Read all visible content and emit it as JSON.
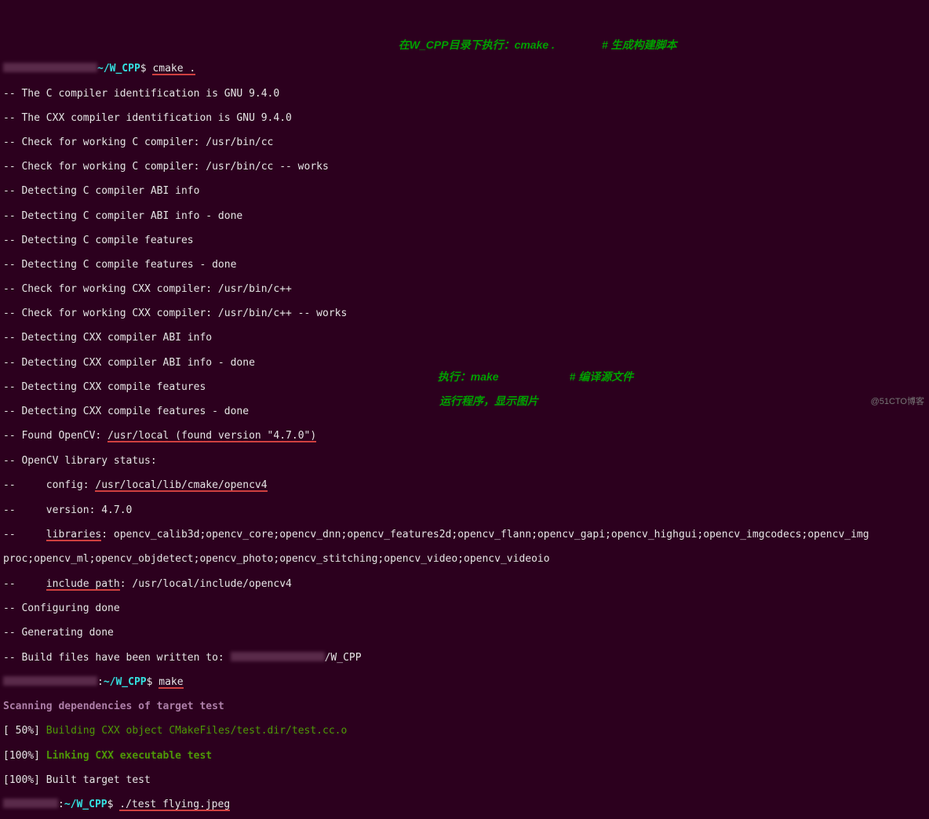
{
  "prompt1": {
    "path": "~/W_CPP",
    "sep": "$ ",
    "cmd": "cmake ."
  },
  "out": {
    "l1": "-- The C compiler identification is GNU 9.4.0",
    "l2": "-- The CXX compiler identification is GNU 9.4.0",
    "l3": "-- Check for working C compiler: /usr/bin/cc",
    "l4": "-- Check for working C compiler: /usr/bin/cc -- works",
    "l5": "-- Detecting C compiler ABI info",
    "l6": "-- Detecting C compiler ABI info - done",
    "l7": "-- Detecting C compile features",
    "l8": "-- Detecting C compile features - done",
    "l9": "-- Check for working CXX compiler: /usr/bin/c++",
    "l10": "-- Check for working CXX compiler: /usr/bin/c++ -- works",
    "l11": "-- Detecting CXX compiler ABI info",
    "l12": "-- Detecting CXX compiler ABI info - done",
    "l13": "-- Detecting CXX compile features",
    "l14": "-- Detecting CXX compile features - done",
    "l15a": "-- Found OpenCV: ",
    "l15b": "/usr/local (found version \"4.7.0\")",
    "l16": "-- OpenCV library status:",
    "l17a": "--     config: ",
    "l17b": "/usr/local/lib/cmake/opencv4",
    "l18": "--     version: 4.7.0",
    "l19a": "--     ",
    "l19b": "libraries",
    "l19c": ": opencv_calib3d;opencv_core;opencv_dnn;opencv_features2d;opencv_flann;opencv_gapi;opencv_highgui;opencv_imgcodecs;opencv_img",
    "l20": "proc;opencv_ml;opencv_objdetect;opencv_photo;opencv_stitching;opencv_video;opencv_videoio",
    "l21a": "--     ",
    "l21b": "include path",
    "l21c": ": /usr/local/include/opencv4",
    "l22": "-- Configuring done",
    "l23": "-- Generating done",
    "l24a": "-- Build files have been written to: ",
    "l24b": "/W_CPP"
  },
  "prompt2": {
    "sep": ":",
    "path": "~/W_CPP",
    "dollar": "$ ",
    "cmd": "make"
  },
  "make": {
    "l1": "Scanning dependencies of target test",
    "l2a": "[ 50%] ",
    "l2b": "Building CXX object CMakeFiles/test.dir/test.cc.o",
    "l3a": "[100%] ",
    "l3b": "Linking CXX executable test",
    "l4": "[100%] Built target test"
  },
  "prompt3": {
    "sep": ":",
    "path": "~/W_CPP",
    "dollar": "$ ",
    "cmd": "./test flying.jpeg"
  },
  "annotations": {
    "a1_left": "在W_CPP目录下执行：cmake .",
    "a1_right": "# 生成构建脚本",
    "a2_left": "执行：make",
    "a2_right": "# 编译源文件",
    "a3": "运行程序，显示图片"
  },
  "watermark": "@51CTO博客"
}
